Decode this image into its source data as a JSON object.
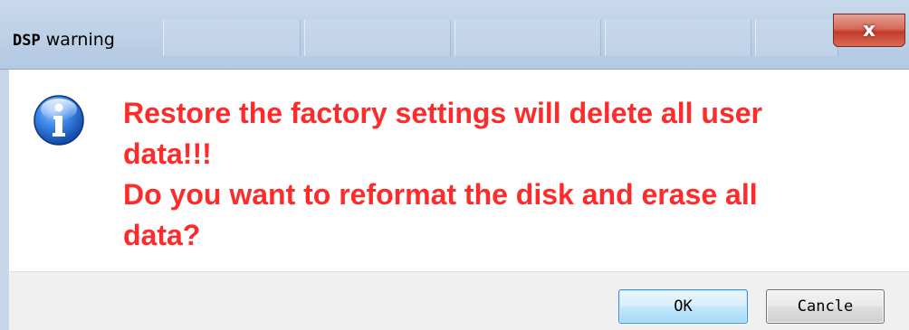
{
  "dialog": {
    "title_prefix": "DSP",
    "title_suffix": " warning",
    "close_label": "x",
    "message_lines": [
      "Restore the factory settings will delete all user",
      "data!!!",
      "Do you want to reformat the disk and erase all",
      "data?"
    ],
    "message_color": "#ff2b2b",
    "icon": "info-icon",
    "buttons": {
      "ok_label": "OK",
      "cancel_label": "Cancle"
    }
  }
}
